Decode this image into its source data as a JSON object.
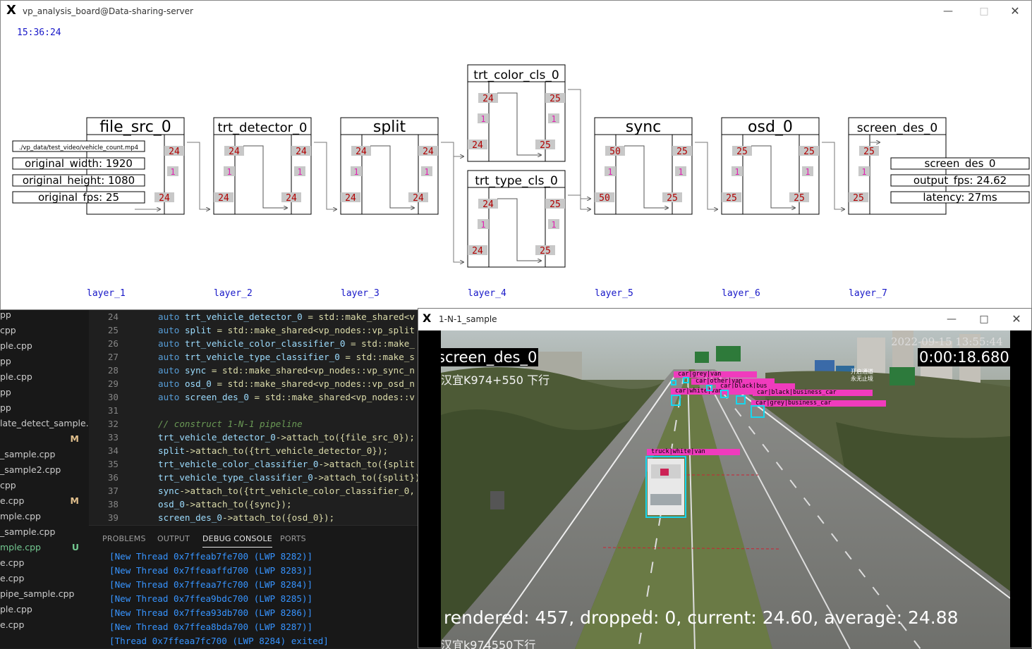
{
  "board": {
    "title": "vp_analysis_board@Data-sharing-server",
    "clock": "15:36:24",
    "layers": [
      "layer_1",
      "layer_2",
      "layer_3",
      "layer_4",
      "layer_5",
      "layer_6",
      "layer_7"
    ],
    "nodes": {
      "file_src": {
        "name": "file_src_0",
        "in_q": "",
        "out_q": "24",
        "mid": "1",
        "out_bottom": "24"
      },
      "detector": {
        "name": "trt_detector_0",
        "in_q": "24",
        "out_q": "24",
        "mid_l": "1",
        "mid_r": "1",
        "in_bottom": "24",
        "out_bottom": "24"
      },
      "split": {
        "name": "split",
        "in_q": "24",
        "out_q": "24",
        "mid_l": "1",
        "mid_r": "1",
        "in_bottom": "24",
        "out_bottom": "24"
      },
      "color_cls": {
        "name": "trt_color_cls_0",
        "in_q": "24",
        "out_q": "25",
        "mid_l": "1",
        "mid_r": "1",
        "in_bottom": "24",
        "out_bottom": "25"
      },
      "type_cls": {
        "name": "trt_type_cls_0",
        "in_q": "24",
        "out_q": "25",
        "mid_l": "1",
        "mid_r": "1",
        "in_bottom": "24",
        "out_bottom": "25"
      },
      "sync": {
        "name": "sync",
        "in_q": "50",
        "out_q": "25",
        "mid_l": "1",
        "mid_r": "1",
        "in_bottom": "50",
        "out_bottom": "25"
      },
      "osd": {
        "name": "osd_0",
        "in_q": "25",
        "out_q": "25",
        "mid_l": "1",
        "mid_r": "1",
        "in_bottom": "25",
        "out_bottom": "25"
      },
      "screen_des": {
        "name": "screen_des_0",
        "in_q": "25",
        "mid_l": "1",
        "in_bottom": "25"
      }
    },
    "src_info": {
      "path": "./vp_data/test_video/vehicle_count.mp4",
      "width": "original_width: 1920",
      "height": "original_height: 1080",
      "fps": "original_fps: 25"
    },
    "des_info": {
      "name": "screen_des_0",
      "fps": "output_fps: 24.62",
      "latency": "latency: 27ms"
    },
    "colors": {
      "queue_bg": "#c8c8c8",
      "queue_text": "#b00000",
      "mid_text": "#e020b0",
      "label_blue": "#1818c8"
    }
  },
  "explorer": {
    "items": [
      {
        "name": "pp",
        "status": ""
      },
      {
        "name": "cpp",
        "status": ""
      },
      {
        "name": "ple.cpp",
        "status": ""
      },
      {
        "name": "pp",
        "status": ""
      },
      {
        "name": "ple.cpp",
        "status": ""
      },
      {
        "name": "pp",
        "status": ""
      },
      {
        "name": "pp",
        "status": ""
      },
      {
        "name": "late_detect_sample....",
        "status": ""
      },
      {
        "name": "",
        "status": "M"
      },
      {
        "name": "_sample.cpp",
        "status": ""
      },
      {
        "name": "_sample2.cpp",
        "status": ""
      },
      {
        "name": "cpp",
        "status": ""
      },
      {
        "name": "e.cpp",
        "status": "M"
      },
      {
        "name": "mple.cpp",
        "status": ""
      },
      {
        "name": "_sample.cpp",
        "status": ""
      },
      {
        "name": "mple.cpp",
        "status": "U"
      },
      {
        "name": "e.cpp",
        "status": ""
      },
      {
        "name": "e.cpp",
        "status": ""
      },
      {
        "name": "pipe_sample.cpp",
        "status": ""
      },
      {
        "name": "ple.cpp",
        "status": ""
      },
      {
        "name": "e.cpp",
        "status": ""
      }
    ]
  },
  "editor": {
    "lines": [
      {
        "n": "24",
        "k": "auto",
        "v": "trt_vehicle_detector_0",
        "rest": " = std::make_shared<v"
      },
      {
        "n": "25",
        "k": "auto",
        "v": "split",
        "rest": " = std::make_shared<vp_nodes::vp_split"
      },
      {
        "n": "26",
        "k": "auto",
        "v": "trt_vehicle_color_classifier_0",
        "rest": " = std::make_"
      },
      {
        "n": "27",
        "k": "auto",
        "v": "trt_vehicle_type_classifier_0",
        "rest": " = std::make_s"
      },
      {
        "n": "28",
        "k": "auto",
        "v": "sync",
        "rest": " = std::make_shared<vp_nodes::vp_sync_n"
      },
      {
        "n": "29",
        "k": "auto",
        "v": "osd_0",
        "rest": " = std::make_shared<vp_nodes::vp_osd_n"
      },
      {
        "n": "30",
        "k": "auto",
        "v": "screen_des_0",
        "rest": " = std::make_shared<vp_nodes::v"
      },
      {
        "n": "31",
        "k": "",
        "v": "",
        "rest": ""
      },
      {
        "n": "32",
        "k": "",
        "v": "",
        "rest": "",
        "comment": "// construct 1-N-1 pipeline"
      },
      {
        "n": "33",
        "k": "",
        "v": "trt_vehicle_detector_0",
        "rest": "->attach_to({file_src_0});"
      },
      {
        "n": "34",
        "k": "",
        "v": "split",
        "rest": "->attach_to({trt_vehicle_detector_0});"
      },
      {
        "n": "35",
        "k": "",
        "v": "trt_vehicle_color_classifier_0",
        "rest": "->attach_to({split"
      },
      {
        "n": "36",
        "k": "",
        "v": "trt_vehicle_type_classifier_0",
        "rest": "->attach_to({split})"
      },
      {
        "n": "37",
        "k": "",
        "v": "sync",
        "rest": "->attach_to({trt_vehicle_color_classifier_0,"
      },
      {
        "n": "38",
        "k": "",
        "v": "osd_0",
        "rest": "->attach_to({sync});"
      },
      {
        "n": "39",
        "k": "",
        "v": "screen_des_0",
        "rest": "->attach_to({osd_0});"
      }
    ]
  },
  "panel": {
    "tabs": [
      "PROBLEMS",
      "OUTPUT",
      "DEBUG CONSOLE",
      "PORTS"
    ],
    "active_tab": "DEBUG CONSOLE",
    "console": [
      "[New Thread 0x7ffeab7fe700 (LWP 8282)]",
      "[New Thread 0x7ffeaaffd700 (LWP 8283)]",
      "[New Thread 0x7ffeaa7fc700 (LWP 8284)]",
      "[New Thread 0x7ffea9bdc700 (LWP 8285)]",
      "[New Thread 0x7ffea93db700 (LWP 8286)]",
      "[New Thread 0x7ffea8bda700 (LWP 8287)]",
      "[Thread 0x7ffeaa7fc700 (LWP 8284) exited]"
    ]
  },
  "video": {
    "title": "1-N-1_sample",
    "node_name": "screen_des_0",
    "elapsed": "0:00:18.680",
    "timestamp": "2022-09-15 13:55:44",
    "location_top": "汉宜K974+550 下行",
    "location_bottom": "汉宜k974550下行",
    "stats": "rendered: 457, dropped: 0, current: 24.60, average: 24.88",
    "sign_text": "开启通道\n永无止境",
    "detections": [
      {
        "label": "car|grey|van"
      },
      {
        "label": "car|other|van"
      },
      {
        "label": "car|black|bus"
      },
      {
        "label": "car|white|van"
      },
      {
        "label": "car|black|business_car"
      },
      {
        "label": "car|grey|business_car"
      },
      {
        "label": "truck|white|van"
      }
    ]
  }
}
